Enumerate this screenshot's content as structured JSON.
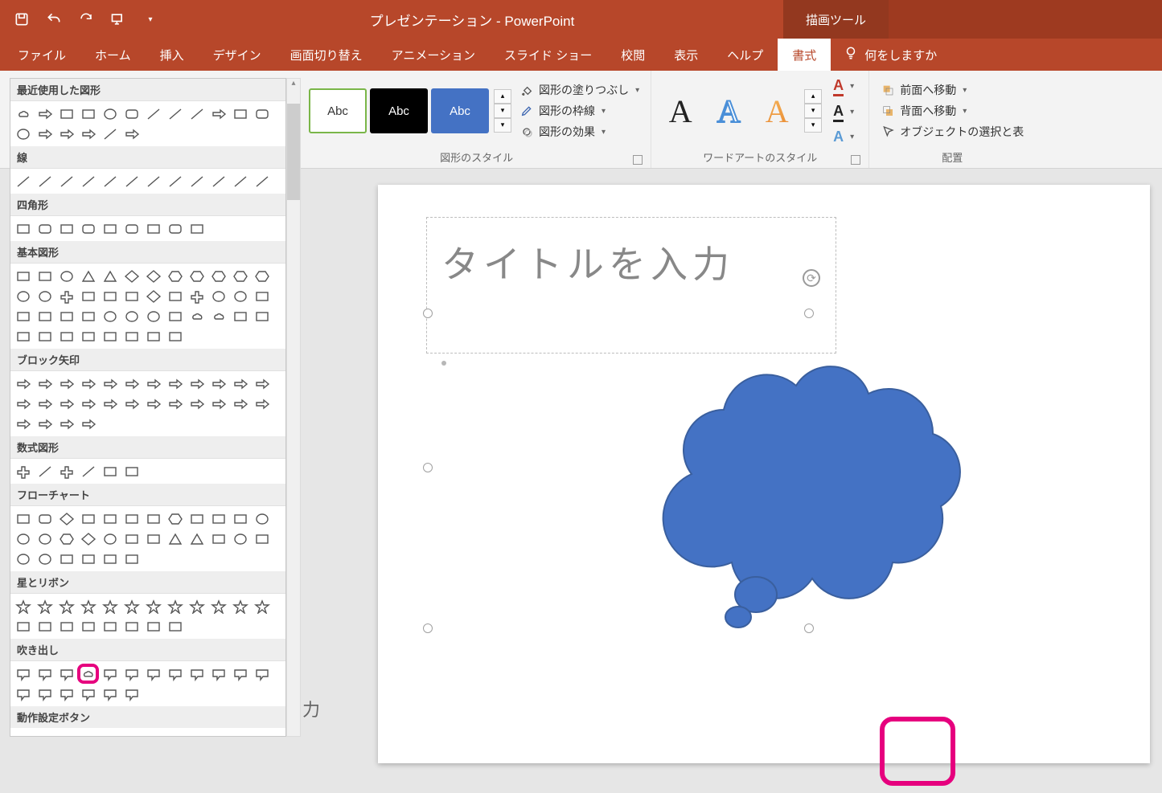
{
  "app": {
    "title": "プレゼンテーション - PowerPoint",
    "context_tab": "描画ツール"
  },
  "ribbon_tabs": [
    "ファイル",
    "ホーム",
    "挿入",
    "デザイン",
    "画面切り替え",
    "アニメーション",
    "スライド ショー",
    "校閲",
    "表示",
    "ヘルプ",
    "書式"
  ],
  "active_tab": "書式",
  "tellme": "何をしますか",
  "style_swatch_label": "Abc",
  "shape_fill": "図形の塗りつぶし",
  "shape_outline": "図形の枠線",
  "shape_effects": "図形の効果",
  "group_shape_styles": "図形のスタイル",
  "group_wordart": "ワードアートのスタイル",
  "group_arrange": "配置",
  "bring_forward": "前面へ移動",
  "send_backward": "背面へ移動",
  "selection_pane": "オブジェクトの選択と表",
  "wa_letter": "A",
  "gallery": {
    "recent": "最近使用した図形",
    "lines": "線",
    "rectangles": "四角形",
    "basic": "基本図形",
    "block_arrows": "ブロック矢印",
    "equation": "数式図形",
    "flowchart": "フローチャート",
    "stars": "星とリボン",
    "callouts": "吹き出し",
    "action": "動作設定ボタン"
  },
  "slide": {
    "title_placeholder": "タイトルを入力"
  },
  "truncated": "力",
  "colors": {
    "brand": "#b7472a",
    "cloud_fill": "#4472c4",
    "cloud_stroke": "#3a5f9e",
    "highlight": "#e6007e"
  }
}
